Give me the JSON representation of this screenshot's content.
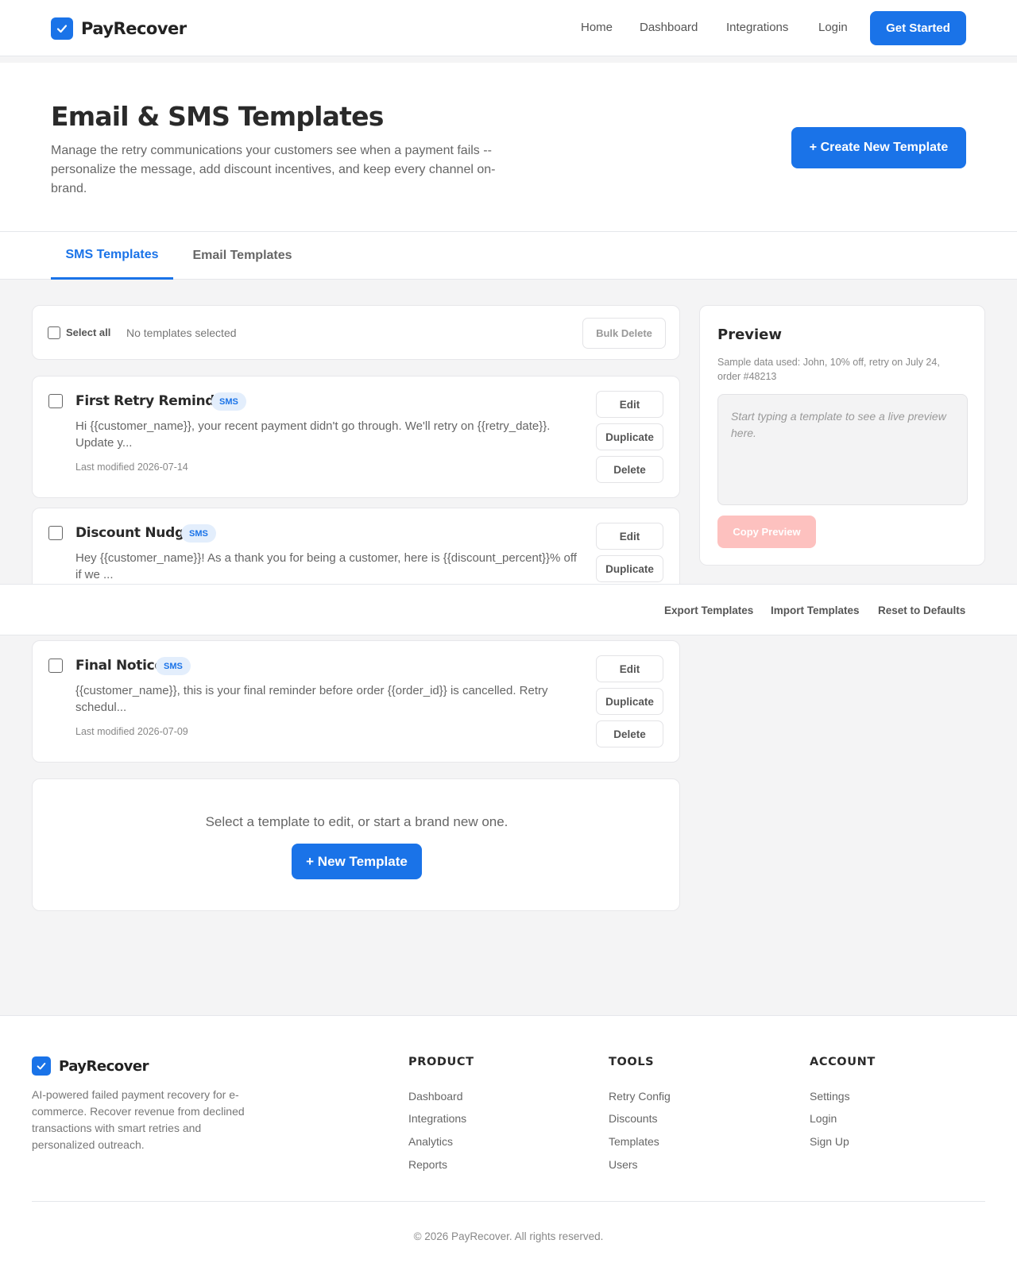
{
  "brand": {
    "name": "PayRecover",
    "logo_icon": "check-icon",
    "accent": "#1a73e8"
  },
  "nav": {
    "links": [
      "Home",
      "Dashboard",
      "Integrations",
      "Login"
    ],
    "cta": "Get Started"
  },
  "header": {
    "title": "Email & SMS Templates",
    "description": "Manage the retry communications your customers see when a payment fails -- personalize the message, add discount incentives, and keep every channel on-brand.",
    "create_button": "+ Create New Template"
  },
  "tabs": [
    {
      "label": "SMS Templates",
      "active": true
    },
    {
      "label": "Email Templates",
      "active": false
    }
  ],
  "bulk": {
    "select_all": "Select all",
    "status": "No templates selected",
    "delete": "Bulk Delete"
  },
  "templates": [
    {
      "name": "First Retry Reminder",
      "badge": "SMS",
      "body": "Hi {{customer_name}}, your recent payment didn't go through. We'll retry on {{retry_date}}. Update y...",
      "modified": "Last modified 2026-07-14"
    },
    {
      "name": "Discount Nudge",
      "badge": "SMS",
      "body": "Hey {{customer_name}}! As a thank you for being a customer, here is {{discount_percent}}% off if we ...",
      "modified": ""
    },
    {
      "name": "Final Notice",
      "badge": "SMS",
      "body": "{{customer_name}}, this is your final reminder before order {{order_id}} is cancelled. Retry schedul...",
      "modified": "Last modified 2026-07-09"
    }
  ],
  "template_actions": {
    "edit": "Edit",
    "duplicate": "Duplicate",
    "delete": "Delete"
  },
  "preview": {
    "title": "Preview",
    "note": "Sample data used: John, 10% off, retry on July 24, order #48213",
    "placeholder": "Start typing a template to see a live preview here.",
    "copy": "Copy Preview"
  },
  "action_bar": {
    "export": "Export Templates",
    "import": "Import Templates",
    "reset": "Reset to Defaults"
  },
  "empty_state": {
    "text": "Select a template to edit, or start a brand new one.",
    "button": "+ New Template"
  },
  "footer": {
    "description": "AI-powered failed payment recovery for e-commerce. Recover revenue from declined transactions with smart retries and personalized outreach.",
    "columns": [
      {
        "heading": "PRODUCT",
        "links": [
          "Dashboard",
          "Integrations",
          "Analytics",
          "Reports"
        ]
      },
      {
        "heading": "TOOLS",
        "links": [
          "Retry Config",
          "Discounts",
          "Templates",
          "Users"
        ]
      },
      {
        "heading": "ACCOUNT",
        "links": [
          "Settings",
          "Login",
          "Sign Up"
        ]
      }
    ],
    "copyright": "© 2026 PayRecover. All rights reserved."
  }
}
